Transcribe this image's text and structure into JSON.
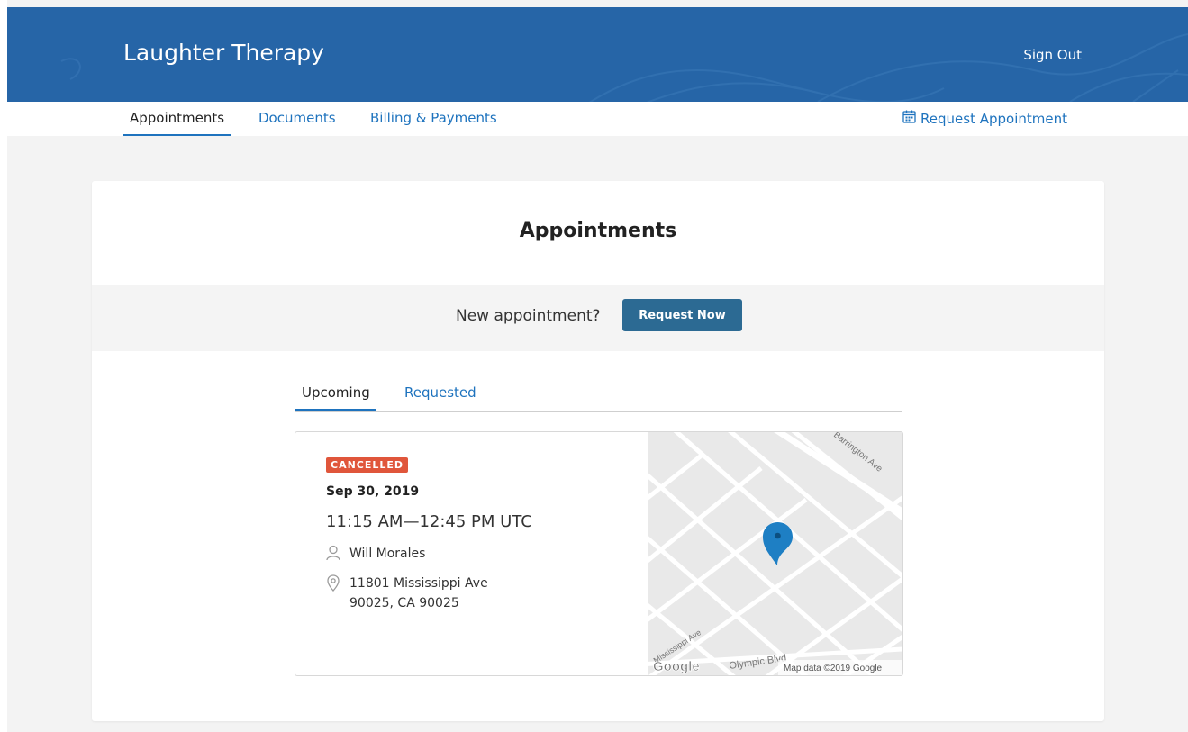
{
  "header": {
    "brand": "Laughter Therapy",
    "sign_out": "Sign Out",
    "color": "#2665a7"
  },
  "nav": {
    "tabs": [
      {
        "label": "Appointments",
        "active": true
      },
      {
        "label": "Documents",
        "active": false
      },
      {
        "label": "Billing & Payments",
        "active": false
      }
    ],
    "request_appointment": "Request Appointment",
    "request_icon": "calendar-icon"
  },
  "page": {
    "title": "Appointments",
    "new_prompt": "New appointment?",
    "request_now": "Request Now"
  },
  "appointment_tabs": [
    {
      "label": "Upcoming",
      "active": true
    },
    {
      "label": "Requested",
      "active": false
    }
  ],
  "appointment": {
    "status": "CANCELLED",
    "status_color": "#e0563b",
    "date": "Sep 30, 2019",
    "time": "11:15 AM—12:45 PM UTC",
    "provider": "Will Morales",
    "provider_icon": "person-icon",
    "address_line1": "11801 Mississippi Ave",
    "address_line2": "90025, CA 90025",
    "address_icon": "location-pin-icon"
  },
  "map": {
    "street_1": "Barrington Ave",
    "street_2": "Mississippi Ave",
    "street_3": "Olympic Blvd",
    "logo": "Google",
    "attribution": "Map data ©2019 Google",
    "marker_color": "#1e7fc4"
  }
}
